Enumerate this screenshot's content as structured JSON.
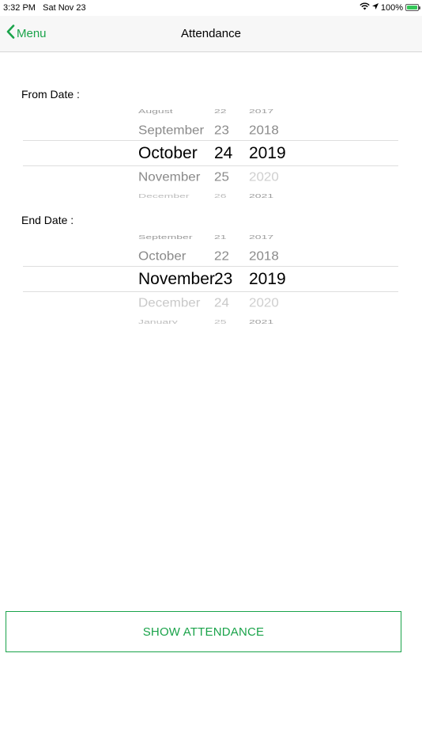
{
  "status_bar": {
    "time": "3:32 PM",
    "date": "Sat Nov 23",
    "battery": "100%",
    "icons": [
      "wifi-icon",
      "location-icon",
      "battery-charging-icon"
    ]
  },
  "nav": {
    "back_label": "Menu",
    "title": "Attendance",
    "accent_color": "#1aa34a"
  },
  "from_date": {
    "label": "From Date :",
    "months": [
      "August",
      "September",
      "October",
      "November",
      "December"
    ],
    "days": [
      "22",
      "23",
      "24",
      "25",
      "26"
    ],
    "years": [
      "2017",
      "2018",
      "2019",
      "2020",
      "2021"
    ],
    "selected": {
      "month": "October",
      "day": "24",
      "year": "2019"
    }
  },
  "end_date": {
    "label": "End Date :",
    "months": [
      "September",
      "October",
      "November",
      "December",
      "January"
    ],
    "days": [
      "21",
      "22",
      "23",
      "24",
      "25"
    ],
    "years": [
      "2017",
      "2018",
      "2019",
      "2020",
      "2021"
    ],
    "selected": {
      "month": "November",
      "day": "23",
      "year": "2019"
    }
  },
  "action": {
    "label": "SHOW ATTENDANCE"
  }
}
